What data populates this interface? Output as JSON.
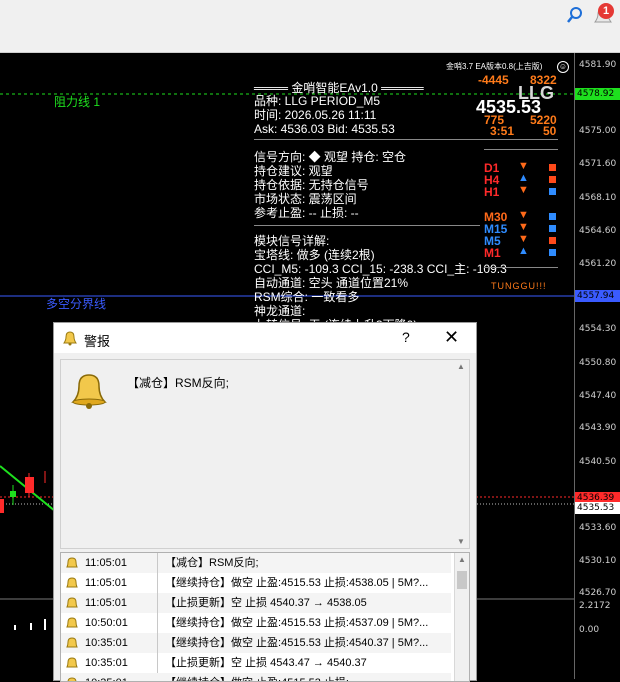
{
  "topbar": {
    "badge": "1"
  },
  "chart": {
    "price_ticks": [
      "4581.90",
      "4575.00",
      "4571.60",
      "4568.10",
      "4564.60",
      "4561.20",
      "4554.30",
      "4550.80",
      "4547.40",
      "4543.90",
      "4540.50",
      "4533.60",
      "4530.10",
      "4526.70"
    ],
    "tag_green": "4578.92",
    "tag_blue": "4557.94",
    "tag_red": "4536.39",
    "tag_bid": "4535.53",
    "indicator_ticks": [
      "2.2172",
      "0.00"
    ],
    "resistance_label": "阻力线 1",
    "trend_label": "多空分界线",
    "top_right": "金哨3.7 EA版本0.8(上吉版)",
    "smile": "☺",
    "num_left_top": "-4445",
    "num_right_top": "8322",
    "symbol_big": "LLG",
    "price_big": "4535.53",
    "num_left_mid": "775",
    "num_right_mid": "5220",
    "num_left_bot": "3:51",
    "num_right_bot": "50",
    "tunggu": "TUNGGU!!!",
    "colors": {
      "green": "#1ee01e",
      "blue": "#3a5bff",
      "red": "#ff2a2a",
      "orange": "#ff7b1a",
      "tf_blue": "#2f8cff"
    },
    "timeframes": [
      {
        "name": "D1",
        "dir": "down",
        "sq": "red"
      },
      {
        "name": "H4",
        "dir": "up",
        "sq": "red"
      },
      {
        "name": "H1",
        "dir": "down",
        "sq": "blue"
      },
      {
        "name": "M30",
        "dir": "down",
        "sq": "blue"
      },
      {
        "name": "M15",
        "dir": "down",
        "sq": "blue"
      },
      {
        "name": "M5",
        "dir": "down",
        "sq": "red"
      },
      {
        "name": "M1",
        "dir": "up",
        "sq": "blue"
      }
    ]
  },
  "ea_panel": {
    "title": "════ 金哨智能EAv1.0 ═════",
    "lines": [
      "品种: LLG  PERIOD_M5",
      "时间: 2026.05.26 11:11",
      "Ask: 4536.03  Bid: 4535.53",
      "信号方向: ◆ 观望  持仓: 空仓",
      "持仓建议: 观望",
      "持仓依据: 无持仓信号",
      "市场状态: 震荡区间",
      "参考止盈: --  止损: --",
      "模块信号详解:",
      "  宝塔线: 做多 (连续2根)",
      "  CCI_M5: -109.3  CCI_15: -238.3  CCI_主: -109.3",
      "  自动通道: 空头 通道位置21%",
      "  RSM综合: 一致看多",
      "  神龙通道:",
      "  九转信号: 无 (连续上升3下降0)"
    ]
  },
  "dialog": {
    "title": "警报",
    "help": "?",
    "close": "✕",
    "message": "【减仓】RSM反向;",
    "rows": [
      {
        "time": "11:05:01",
        "msg": "【减仓】RSM反向;"
      },
      {
        "time": "11:05:01",
        "msg": "【继续持仓】做空 止盈:4515.53 止损:4538.05 | 5M?..."
      },
      {
        "time": "11:05:01",
        "msg": "【止损更新】空 止损 4540.37 → 4538.05"
      },
      {
        "time": "10:50:01",
        "msg": "【继续持仓】做空 止盈:4515.53 止损:4537.09 | 5M?..."
      },
      {
        "time": "10:35:01",
        "msg": "【继续持仓】做空 止盈:4515.53 止损:4540.37 | 5M?..."
      },
      {
        "time": "10:35:01",
        "msg": "【止损更新】空 止损 4543.47 → 4540.37"
      },
      {
        "time": "10:35:01",
        "msg": "【继续持仓】做空 止盈:4515.53 止损:..."
      }
    ]
  }
}
